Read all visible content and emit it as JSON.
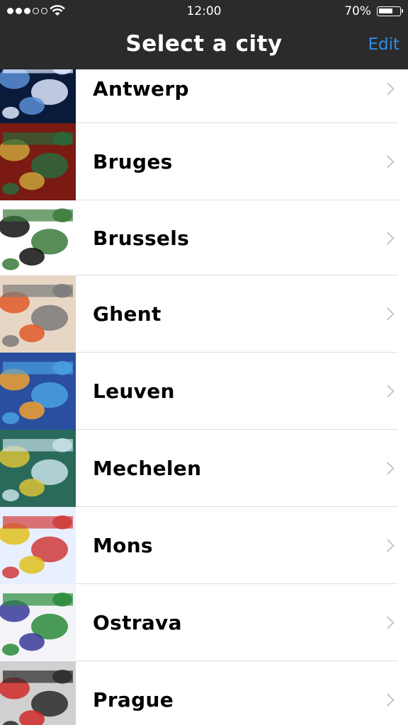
{
  "status_bar": {
    "time": "12:00",
    "battery_percent": "70%",
    "battery_level": 0.7,
    "signal_bars_filled": 3,
    "signal_bars_total": 5
  },
  "nav": {
    "title": "Select a city",
    "edit_label": "Edit"
  },
  "cities": [
    {
      "name": "Antwerp",
      "colors": [
        "#0a1a3a",
        "#5b8fd6",
        "#dfe8ff"
      ]
    },
    {
      "name": "Bruges",
      "colors": [
        "#7a1a12",
        "#c9a23a",
        "#2a6a3a"
      ]
    },
    {
      "name": "Brussels",
      "colors": [
        "#ffffff",
        "#111111",
        "#3a7a3a"
      ]
    },
    {
      "name": "Ghent",
      "colors": [
        "#e8d6c4",
        "#e05a2a",
        "#7a7a7a"
      ]
    },
    {
      "name": "Leuven",
      "colors": [
        "#2a4fa0",
        "#f0a030",
        "#4aa0e0"
      ]
    },
    {
      "name": "Mechelen",
      "colors": [
        "#2a6a5a",
        "#d9c23a",
        "#c8e0e8"
      ]
    },
    {
      "name": "Mons",
      "colors": [
        "#e8f0ff",
        "#e0c020",
        "#d03a3a"
      ]
    },
    {
      "name": "Ostrava",
      "colors": [
        "#f4f4f8",
        "#3a3a9a",
        "#2a8a3a"
      ]
    },
    {
      "name": "Prague",
      "colors": [
        "#d0d0d0",
        "#d02a2a",
        "#2a2a2a"
      ]
    }
  ]
}
